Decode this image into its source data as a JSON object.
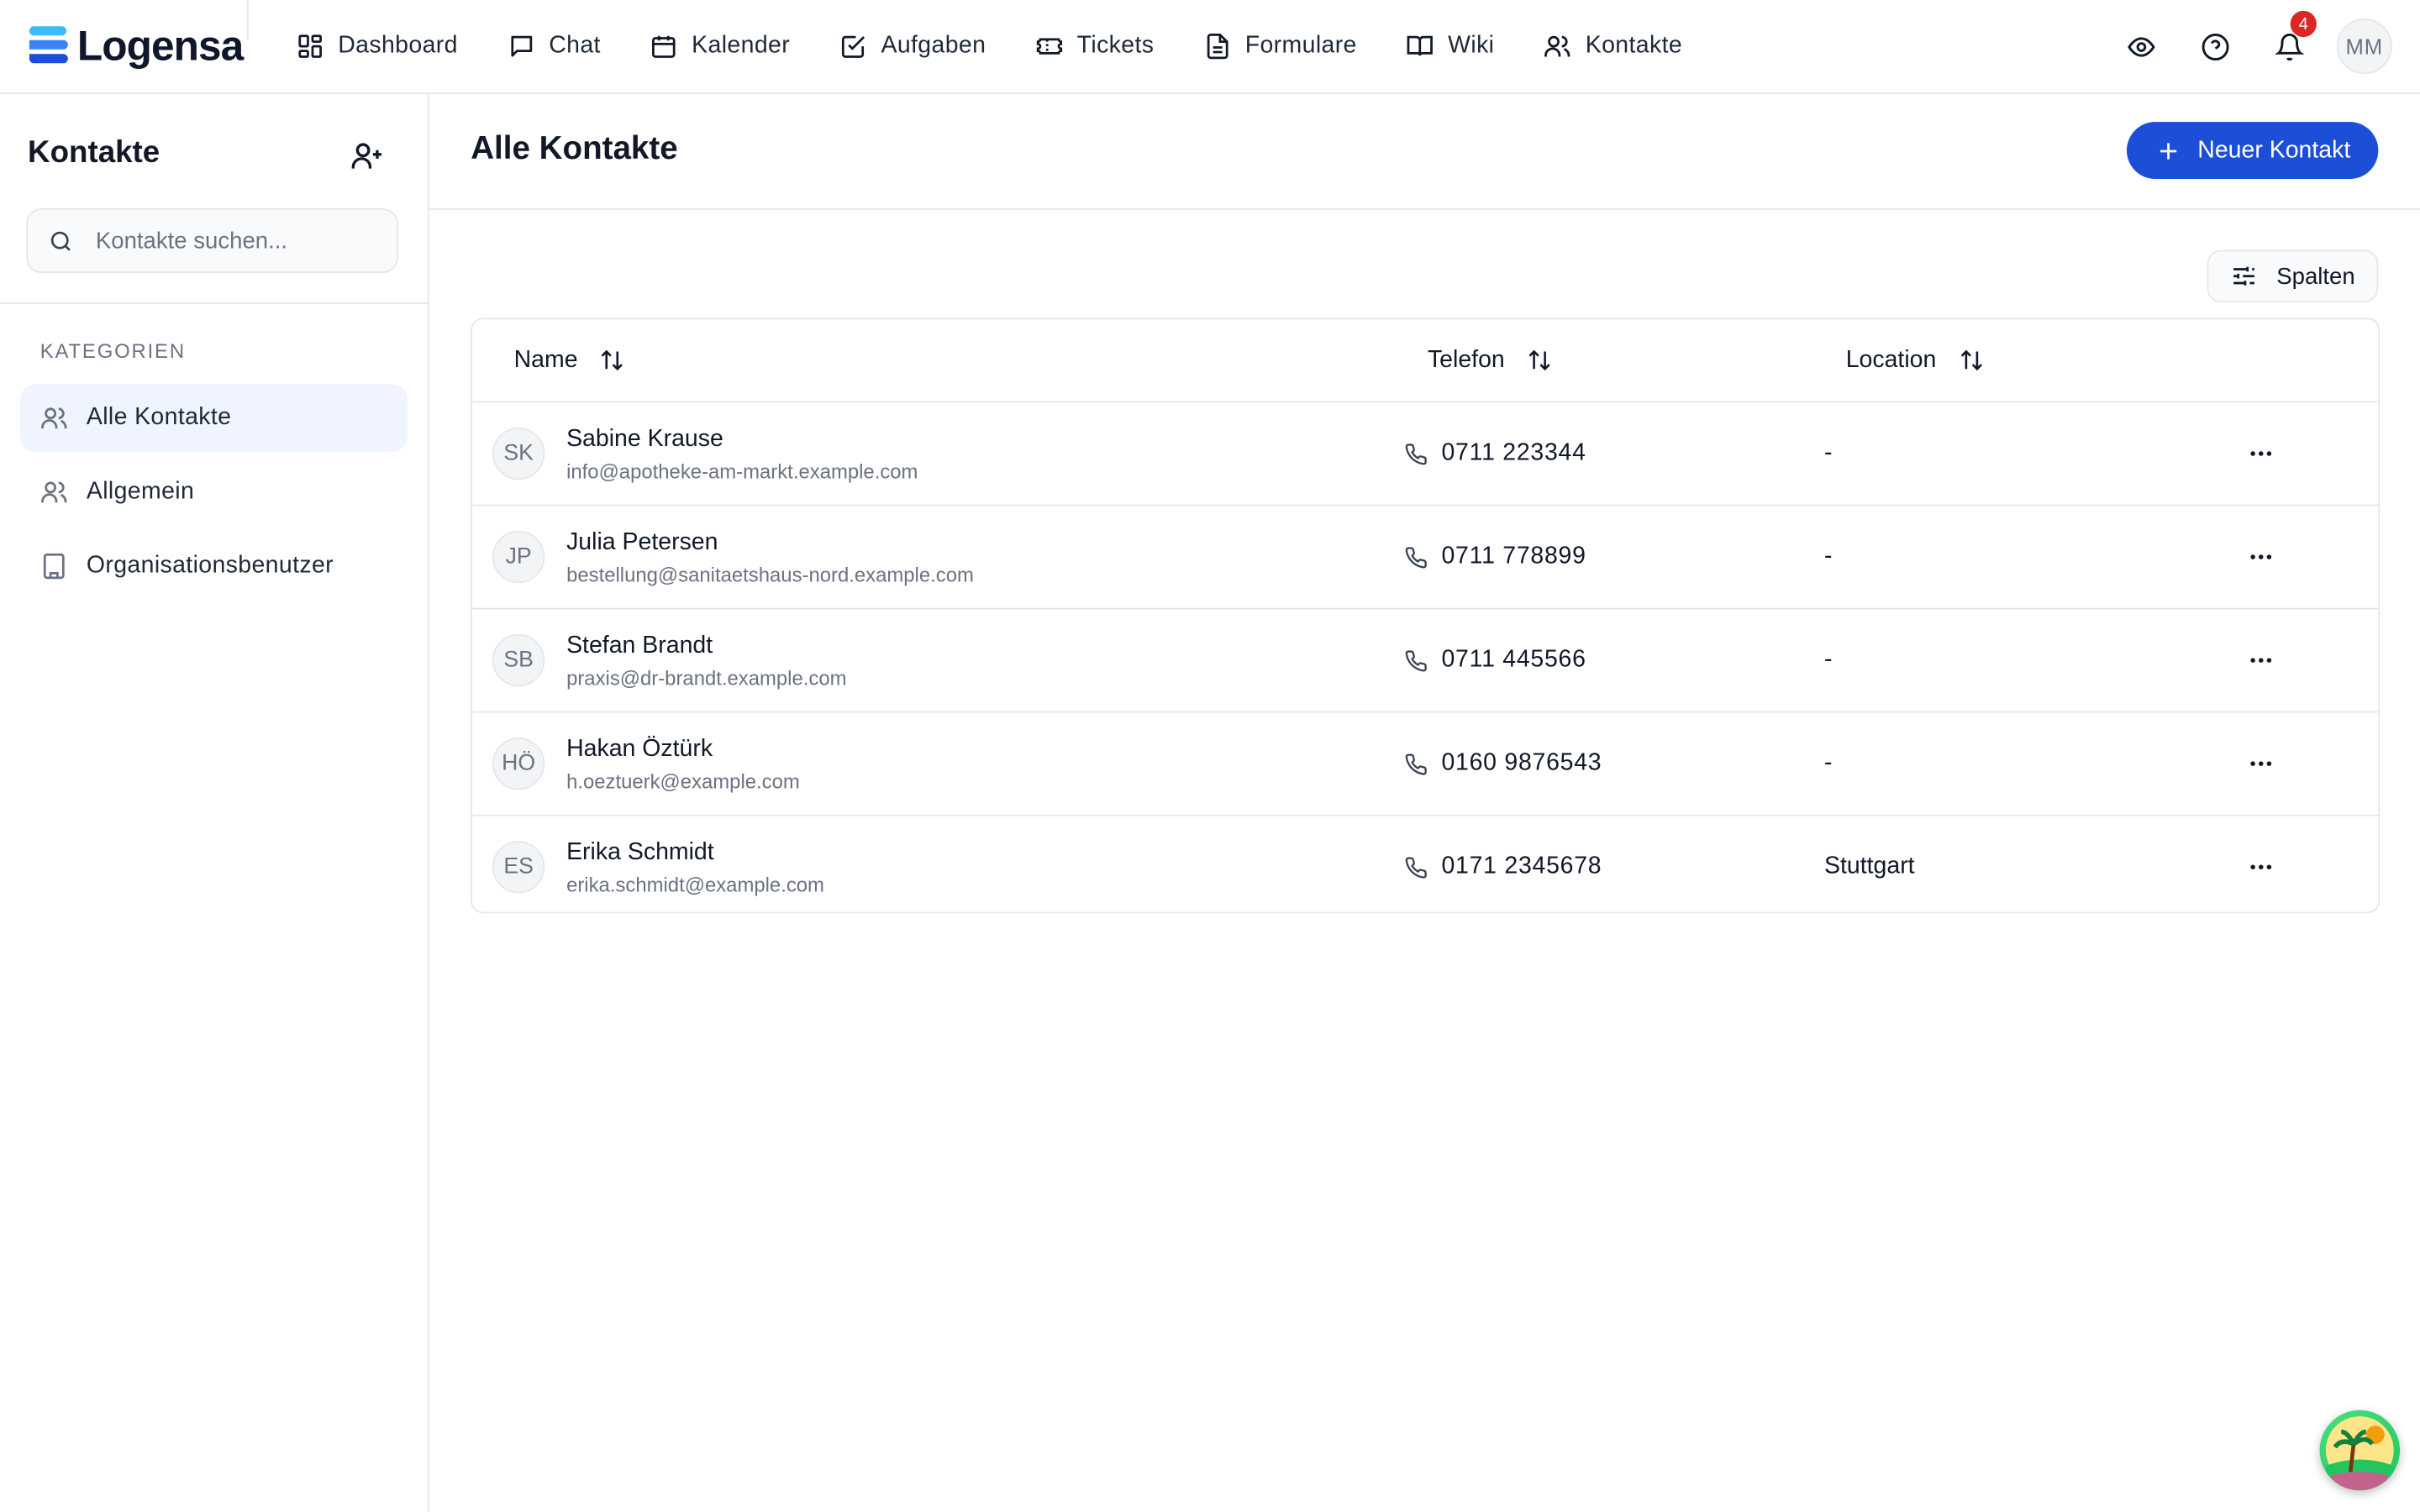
{
  "app": {
    "name": "Logensa"
  },
  "nav": [
    {
      "label": "Dashboard",
      "icon": "dashboard-icon"
    },
    {
      "label": "Chat",
      "icon": "chat-icon"
    },
    {
      "label": "Kalender",
      "icon": "calendar-icon"
    },
    {
      "label": "Aufgaben",
      "icon": "task-check-icon"
    },
    {
      "label": "Tickets",
      "icon": "ticket-icon"
    },
    {
      "label": "Formulare",
      "icon": "form-document-icon"
    },
    {
      "label": "Wiki",
      "icon": "book-icon"
    },
    {
      "label": "Kontakte",
      "icon": "contacts-icon"
    }
  ],
  "header": {
    "notification_count": "4",
    "user_initials": "MM"
  },
  "sidebar": {
    "title": "Kontakte",
    "search_placeholder": "Kontakte suchen...",
    "category_heading": "KATEGORIEN",
    "items": [
      {
        "label": "Alle Kontakte",
        "icon": "users-icon",
        "active": true
      },
      {
        "label": "Allgemein",
        "icon": "users-icon",
        "active": false
      },
      {
        "label": "Organisationsbenutzer",
        "icon": "building-icon",
        "active": false
      }
    ]
  },
  "main": {
    "title": "Alle Kontakte",
    "new_button": "Neuer Kontakt",
    "columns_button": "Spalten",
    "columns": {
      "name": "Name",
      "phone": "Telefon",
      "location": "Location"
    },
    "rows": [
      {
        "initials": "SK",
        "name": "Sabine Krause",
        "email": "info@apotheke-am-markt.example.com",
        "phone": "0711 223344",
        "location": "-"
      },
      {
        "initials": "JP",
        "name": "Julia Petersen",
        "email": "bestellung@sanitaetshaus-nord.example.com",
        "phone": "0711 778899",
        "location": "-"
      },
      {
        "initials": "SB",
        "name": "Stefan Brandt",
        "email": "praxis@dr-brandt.example.com",
        "phone": "0711 445566",
        "location": "-"
      },
      {
        "initials": "HÖ",
        "name": "Hakan Öztürk",
        "email": "h.oeztuerk@example.com",
        "phone": "0160 9876543",
        "location": "-"
      },
      {
        "initials": "ES",
        "name": "Erika Schmidt",
        "email": "erika.schmidt@example.com",
        "phone": "0171 2345678",
        "location": "Stuttgart"
      }
    ]
  },
  "colors": {
    "accent": "#1d4ed8",
    "badge": "#dc2626",
    "active_bg": "#eff4ff"
  }
}
